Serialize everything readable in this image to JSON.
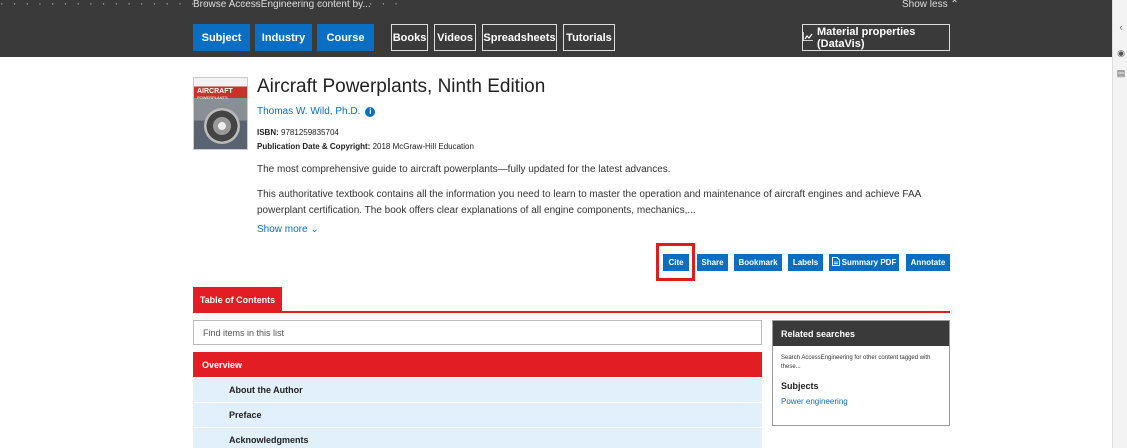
{
  "header": {
    "cutoff_text": "· · · · · · · · · · · · · · · · · · · · · · · · · · · · · · · ·",
    "browse_label": "Browse AccessEngineering content by...",
    "show_less": "Show less ⌃",
    "tabs": [
      {
        "label": "Subject",
        "style": "blue"
      },
      {
        "label": "Industry",
        "style": "blue"
      },
      {
        "label": "Course",
        "style": "blue"
      },
      {
        "label": "Books",
        "style": "outline"
      },
      {
        "label": "Videos",
        "style": "outline"
      },
      {
        "label": "Spreadsheets",
        "style": "outline"
      },
      {
        "label": "Tutorials",
        "style": "outline"
      }
    ],
    "material_button": "Material properties (DataVis)",
    "material_icon": "chart-icon"
  },
  "book": {
    "cover_title": "AIRCRAFT",
    "cover_subtitle": "POWERPLANTS",
    "title": "Aircraft Powerplants, Ninth Edition",
    "author": "Thomas W. Wild, Ph.D.",
    "isbn_label": "ISBN:",
    "isbn": "9781259835704",
    "pubdate_label": "Publication Date & Copyright:",
    "pubdate": "2018 McGraw-Hill Education",
    "tagline": "The most comprehensive guide to aircraft powerplants—fully updated for the latest advances.",
    "description": "This authoritative textbook contains all the information you need to learn to master the operation and maintenance of aircraft engines and achieve FAA powerplant certification. The book offers clear explanations of all engine components, mechanics,...",
    "show_more": "Show more ⌄"
  },
  "actions": {
    "cite": "Cite",
    "share": "Share",
    "bookmark": "Bookmark",
    "labels": "Labels",
    "summary_pdf": "Summary PDF",
    "annotate": "Annotate"
  },
  "toc": {
    "tab_label": "Table of Contents",
    "search_placeholder": "Find items in this list",
    "overview": "Overview",
    "items": [
      "About the Author",
      "Preface",
      "Acknowledgments"
    ]
  },
  "related": {
    "header": "Related searches",
    "description": "Search AccessEngineering for other content tagged with these...",
    "subjects_label": "Subjects",
    "subject_link": "Power engineering"
  },
  "colors": {
    "accent_blue": "#0a6fc2",
    "accent_red": "#e21d23",
    "dark_bar": "#3a3a3a",
    "toc_item_bg": "#e2f0fb"
  }
}
